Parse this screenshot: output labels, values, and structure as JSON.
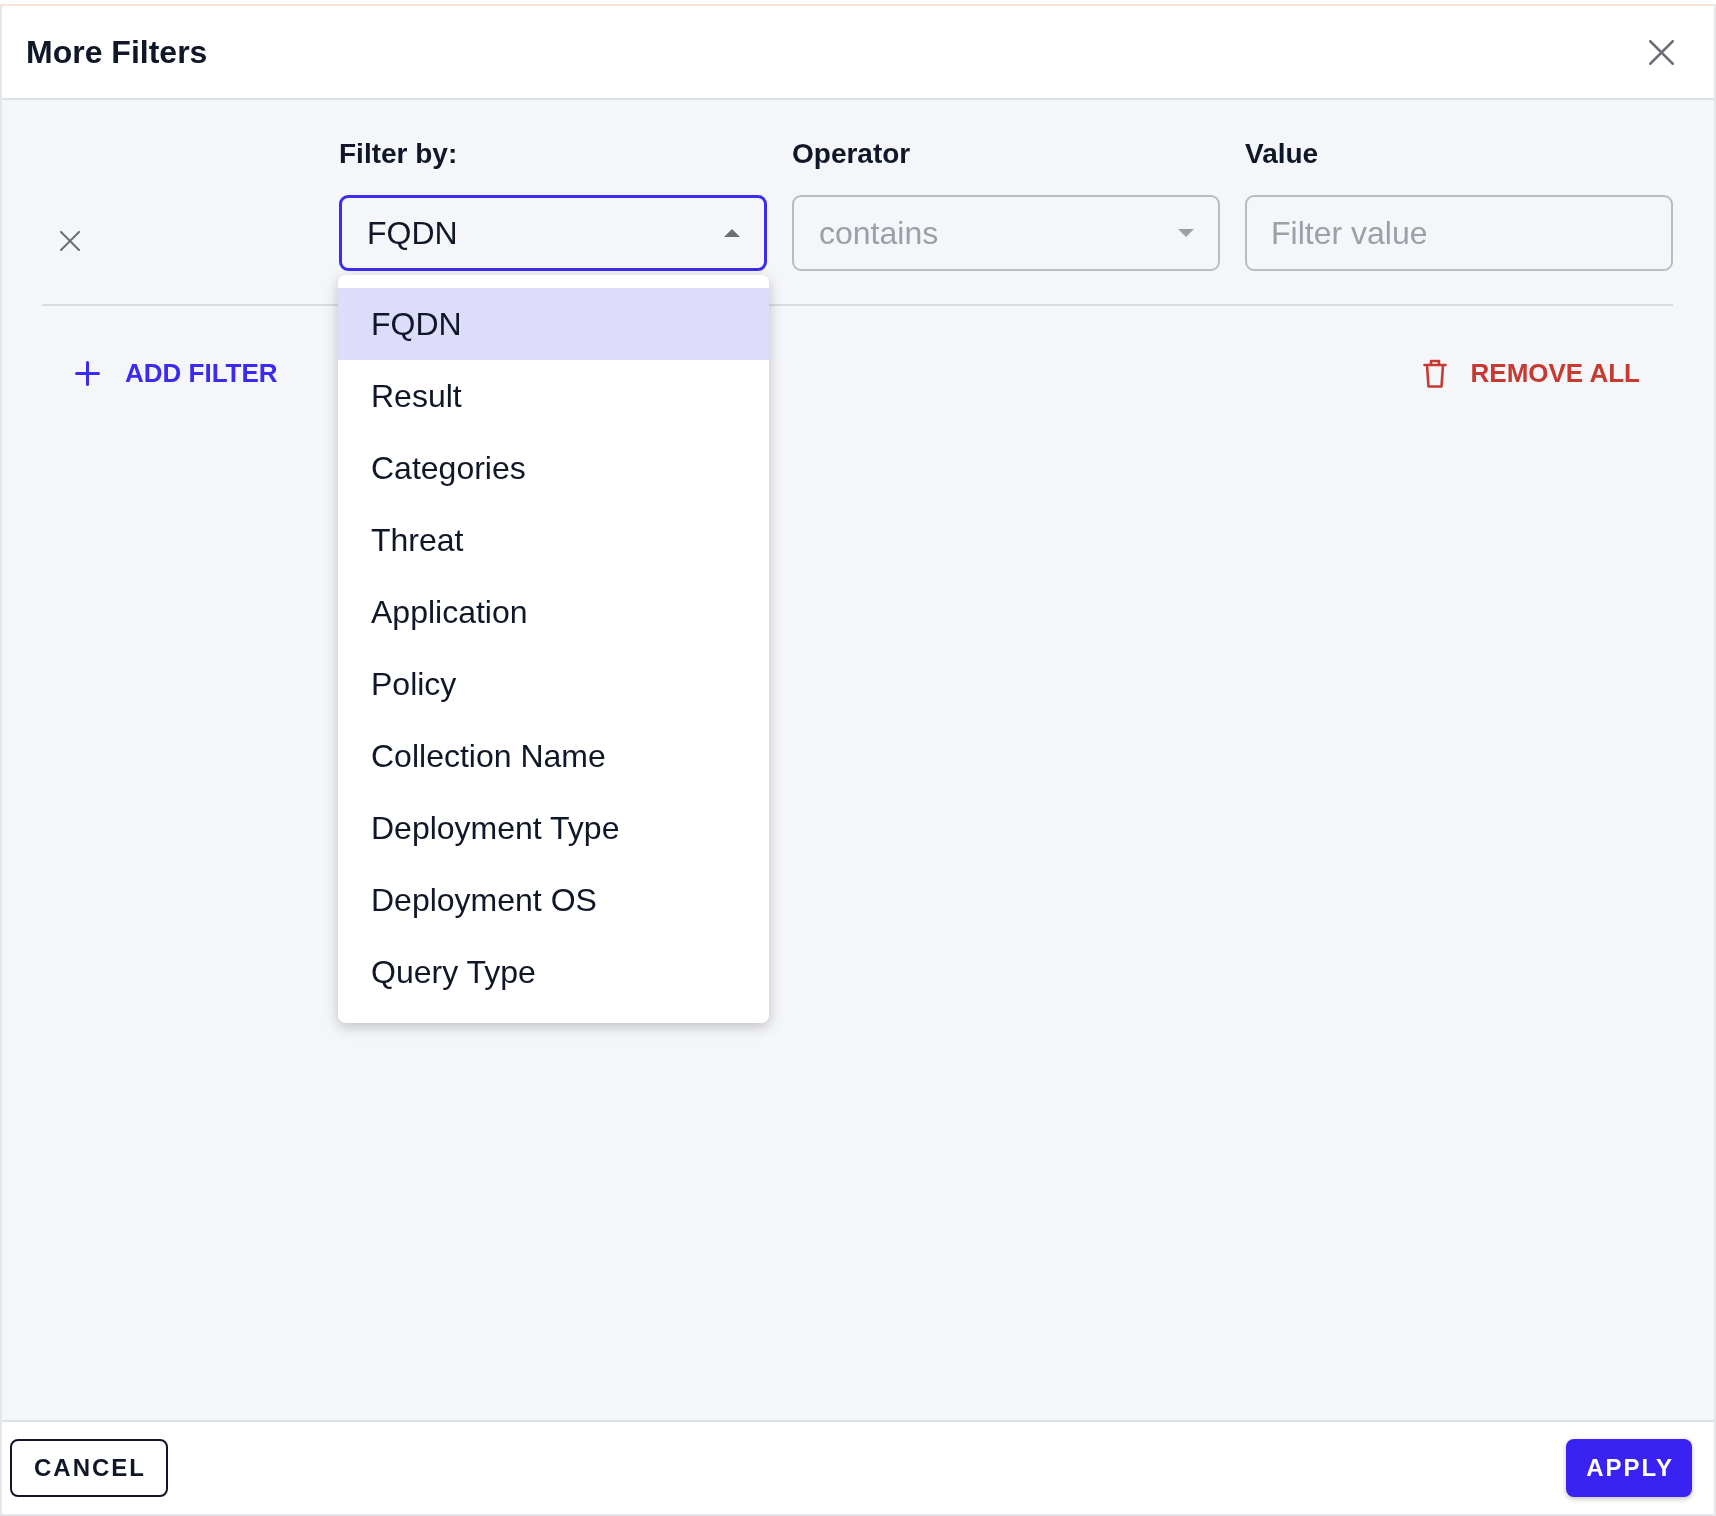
{
  "dialog": {
    "title": "More Filters"
  },
  "filter_rows": [
    {
      "filter_by": {
        "label": "Filter by:",
        "value": "FQDN",
        "expanded": true,
        "options": [
          {
            "label": "FQDN",
            "selected": true
          },
          {
            "label": "Result",
            "selected": false
          },
          {
            "label": "Categories",
            "selected": false
          },
          {
            "label": "Threat",
            "selected": false
          },
          {
            "label": "Application",
            "selected": false
          },
          {
            "label": "Policy",
            "selected": false
          },
          {
            "label": "Collection Name",
            "selected": false
          },
          {
            "label": "Deployment Type",
            "selected": false
          },
          {
            "label": "Deployment OS",
            "selected": false
          },
          {
            "label": "Query Type",
            "selected": false
          }
        ]
      },
      "operator": {
        "label": "Operator",
        "placeholder": "contains"
      },
      "value": {
        "label": "Value",
        "placeholder": "Filter value"
      }
    }
  ],
  "add_filter": "ADD FILTER",
  "remove_all": "REMOVE ALL",
  "footer": {
    "cancel": "CANCEL",
    "apply": "APPLY"
  }
}
